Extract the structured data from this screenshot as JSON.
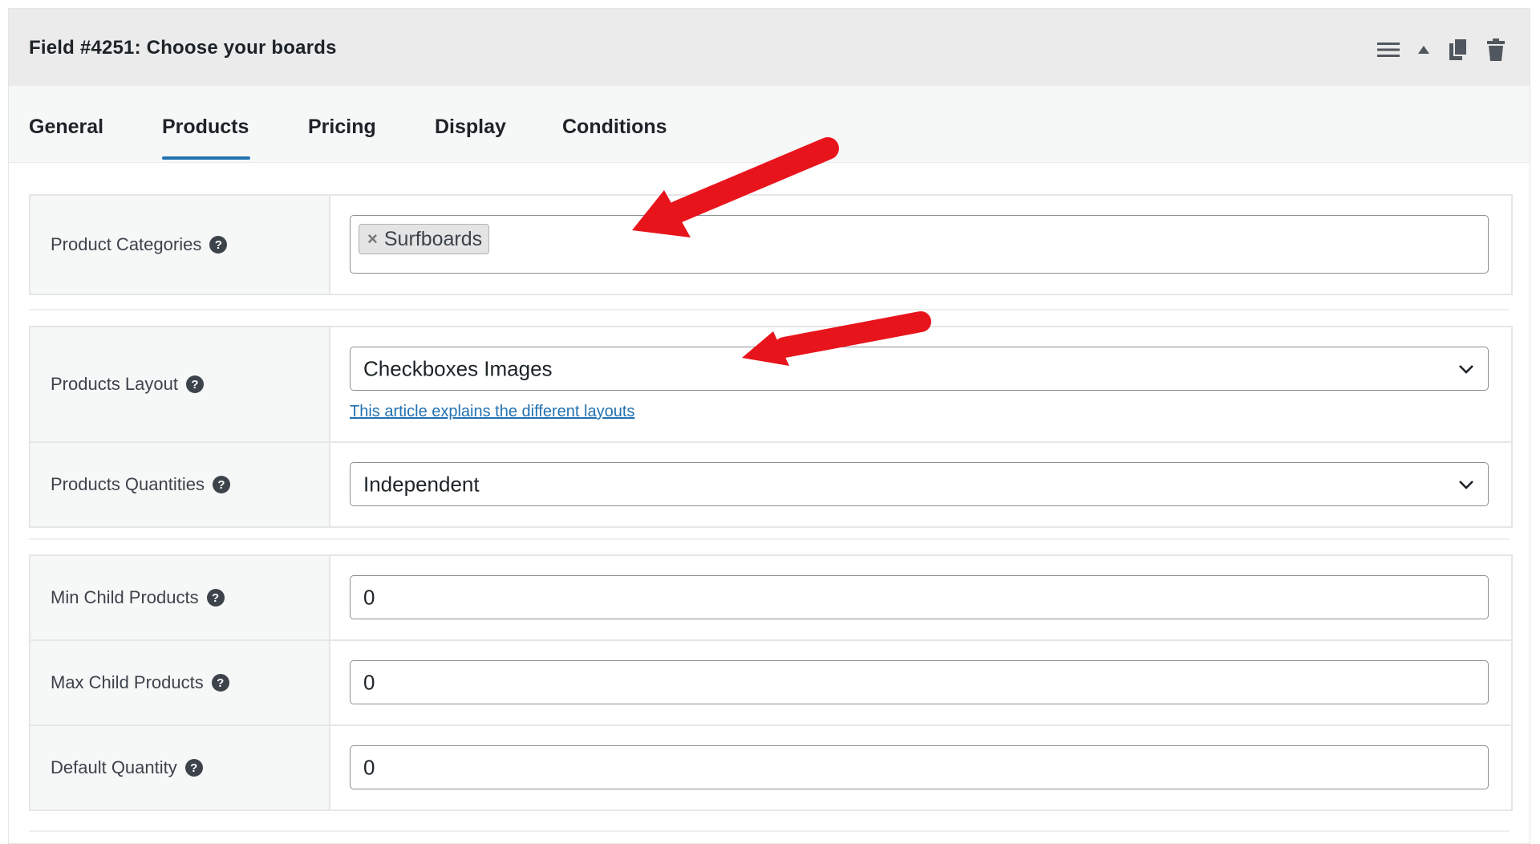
{
  "header": {
    "title": "Field #4251: Choose your boards",
    "icons": [
      "menu-icon",
      "collapse-arrow-icon",
      "duplicate-icon",
      "trash-icon"
    ]
  },
  "tabs": [
    {
      "label": "General",
      "active": false
    },
    {
      "label": "Products",
      "active": true
    },
    {
      "label": "Pricing",
      "active": false
    },
    {
      "label": "Display",
      "active": false
    },
    {
      "label": "Conditions",
      "active": false
    }
  ],
  "fields": {
    "product_categories": {
      "label": "Product Categories",
      "tags": [
        {
          "label": "Surfboards",
          "remove": "×"
        }
      ]
    },
    "products_layout": {
      "label": "Products Layout",
      "value": "Checkboxes Images",
      "help_link": "This article explains the different layouts"
    },
    "products_quantities": {
      "label": "Products Quantities",
      "value": "Independent"
    },
    "min_child_products": {
      "label": "Min Child Products",
      "value": "0"
    },
    "max_child_products": {
      "label": "Max Child Products",
      "value": "0"
    },
    "default_quantity": {
      "label": "Default Quantity",
      "value": "0"
    }
  },
  "help_glyph": "?",
  "colors": {
    "accent": "#2271b1",
    "annotation_arrow": "#e8141c",
    "header_bg": "#ebebeb",
    "label_bg": "#f6f7f7"
  }
}
